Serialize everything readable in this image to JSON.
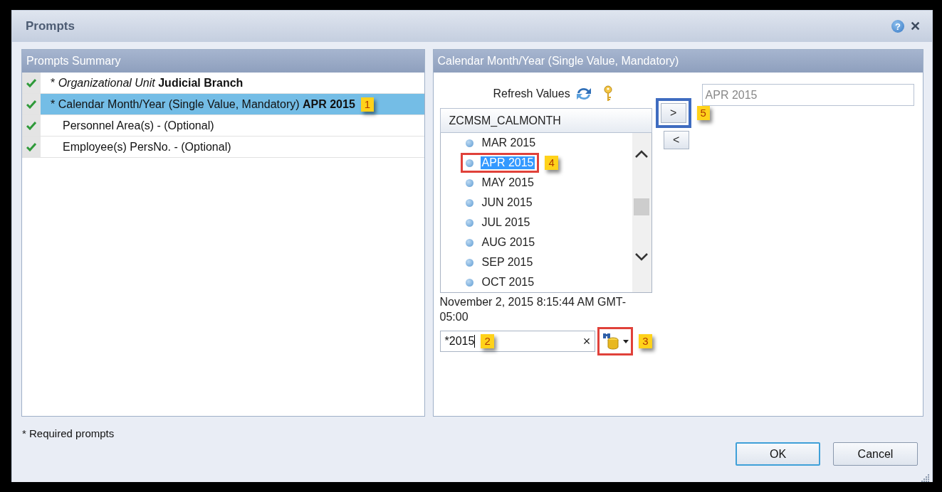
{
  "window": {
    "title": "Prompts",
    "help": "?",
    "close": "✕"
  },
  "summary": {
    "title": "Prompts Summary",
    "items": [
      {
        "kind": "required",
        "text": "* *Organizational Unit* **Judicial Branch**",
        "checked": true,
        "selected": false
      },
      {
        "kind": "required",
        "text": "* Calendar Month/Year (Single Value, Mandatory) **APR 2015**",
        "checked": true,
        "selected": true,
        "callout": {
          "number": "1"
        }
      },
      {
        "kind": "optional",
        "text": "Personnel Area(s) - (Optional)",
        "checked": true,
        "selected": false
      },
      {
        "kind": "optional",
        "text": "Employee(s) PersNo. - (Optional)",
        "checked": true,
        "selected": false
      }
    ]
  },
  "detail": {
    "title": "Calendar Month/Year (Single Value, Mandatory)",
    "refresh_label": "Refresh Values",
    "list_header": "ZCMSM_CALMONTH",
    "values": [
      {
        "label": "MAR 2015",
        "selected": false
      },
      {
        "label": "APR 2015",
        "selected": true,
        "callout": {
          "number": "4",
          "color": "#e0413a"
        }
      },
      {
        "label": "MAY 2015",
        "selected": false
      },
      {
        "label": "JUN 2015",
        "selected": false
      },
      {
        "label": "JUL 2015",
        "selected": false
      },
      {
        "label": "AUG 2015",
        "selected": false
      },
      {
        "label": "SEP 2015",
        "selected": false
      },
      {
        "label": "OCT 2015",
        "selected": false
      }
    ],
    "timestamp": "November 2, 2015 8:15:44 AM GMT-05:00",
    "search": {
      "value": "*2015",
      "clear": "×",
      "callout": {
        "number": "2"
      }
    },
    "lookup": {
      "callout": {
        "number": "3",
        "color": "#e0413a"
      }
    },
    "add_button": {
      "label": ">",
      "callout": {
        "number": "5",
        "color": "#3f6cc0"
      }
    },
    "remove_button": {
      "label": "<"
    },
    "selected_value": "APR 2015"
  },
  "footer": {
    "note": "* Required prompts",
    "buttons": [
      {
        "label": "OK",
        "default": true
      },
      {
        "label": "Cancel",
        "default": false
      }
    ]
  }
}
